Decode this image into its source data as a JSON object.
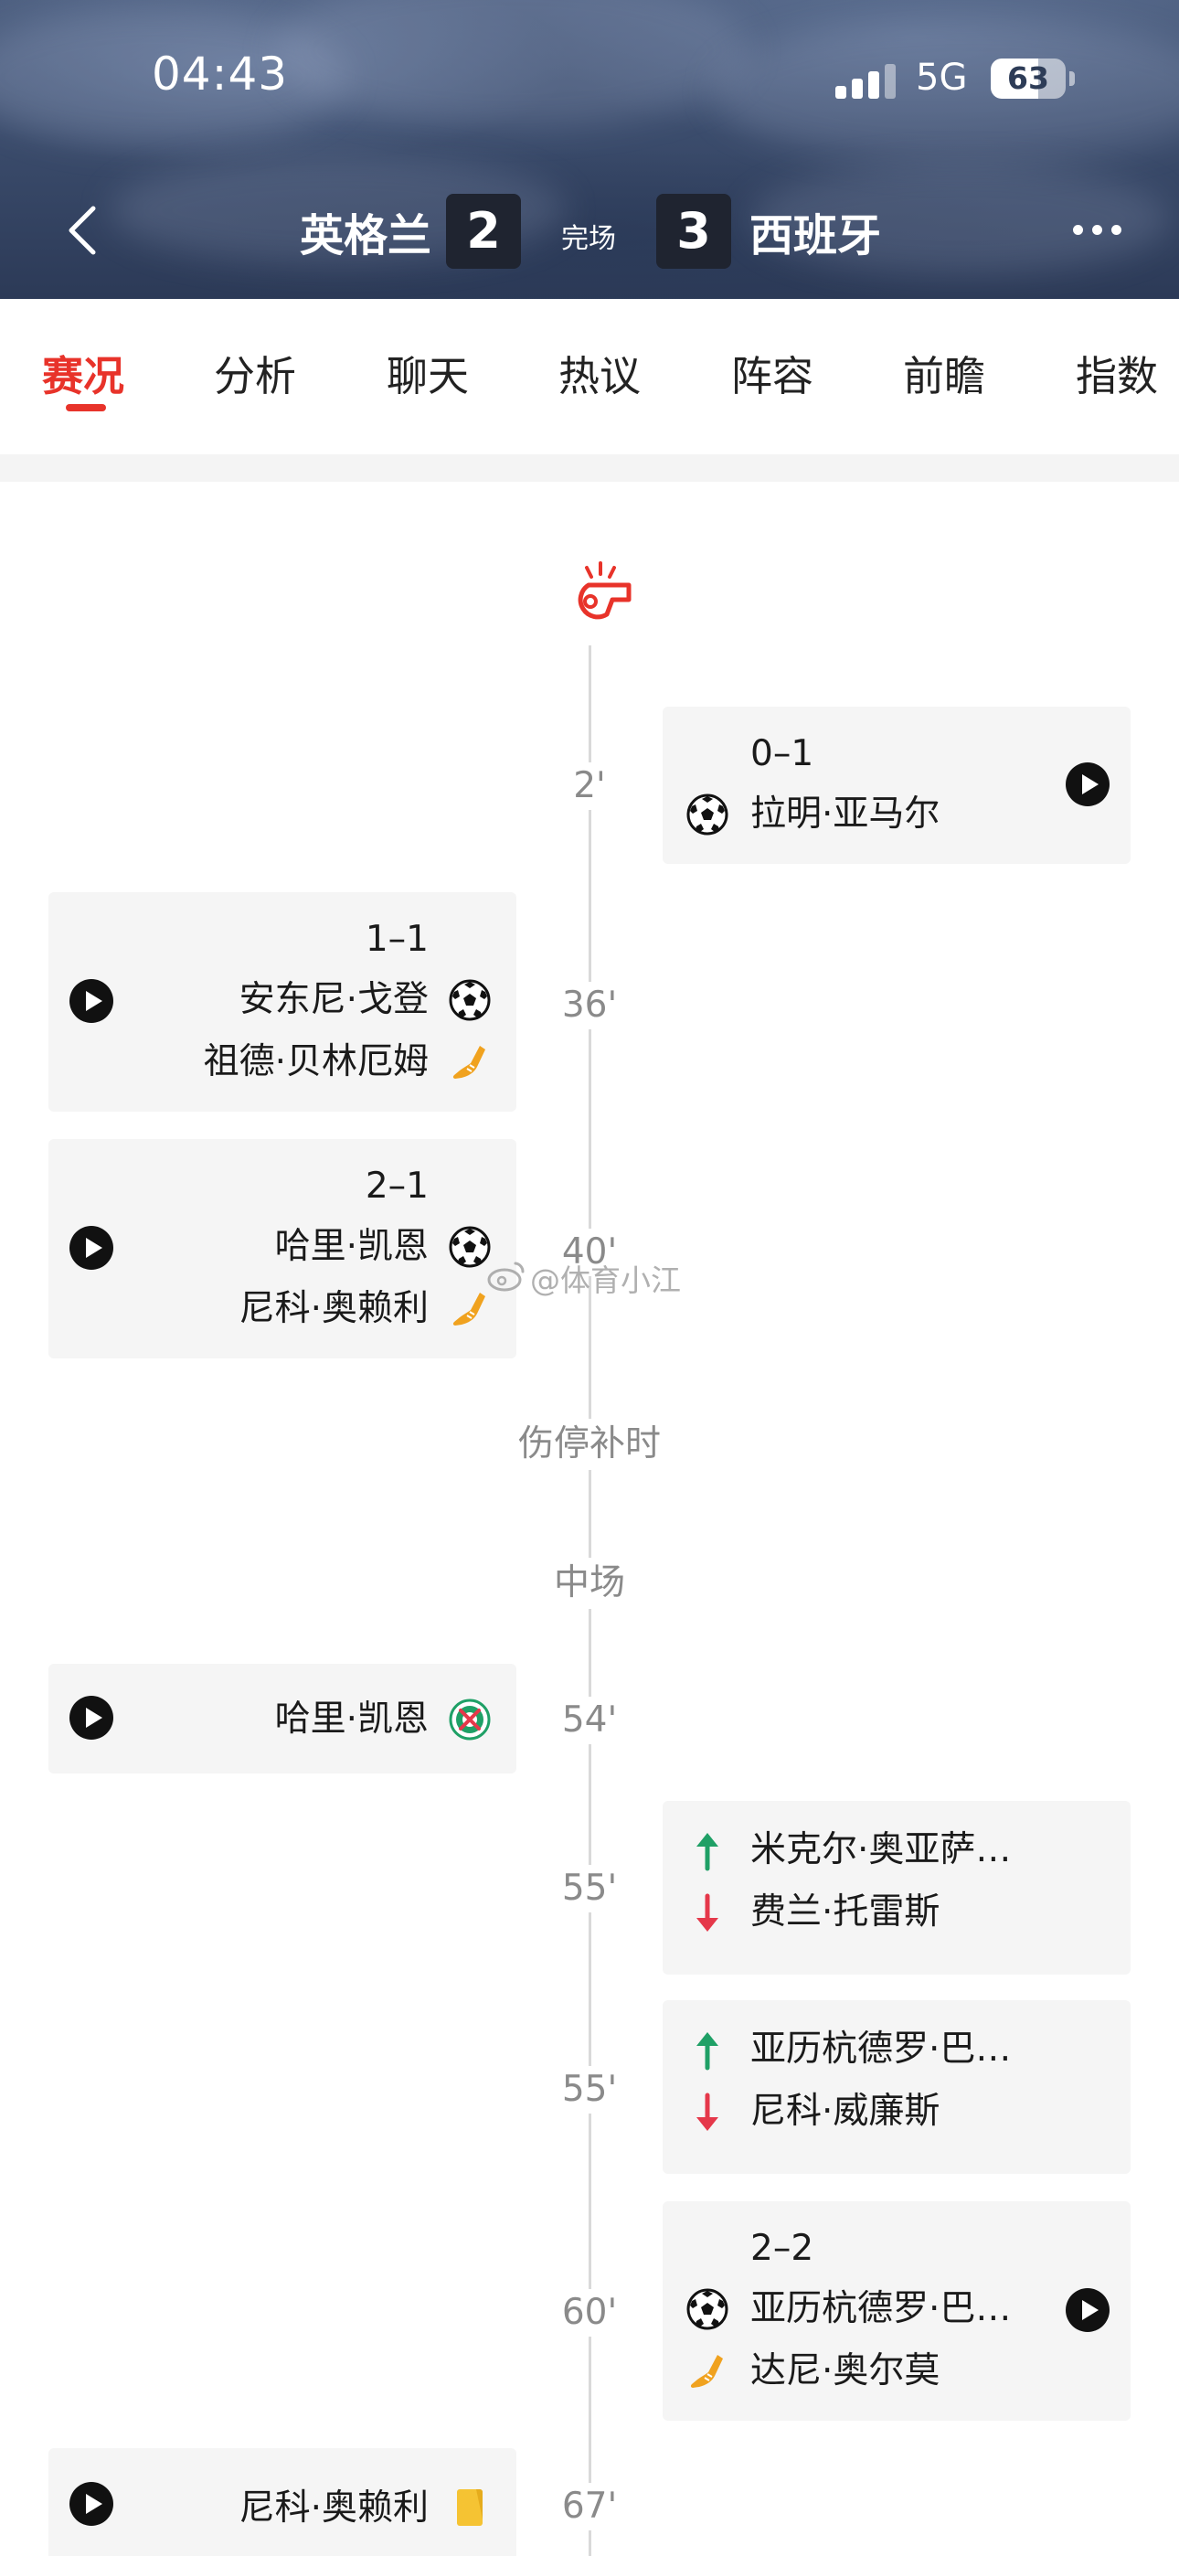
{
  "status_bar": {
    "time": "04:43",
    "network": "5G",
    "battery": "63",
    "battery_level": 0.63
  },
  "header": {
    "home_team": "英格兰",
    "home_score": "2",
    "status": "完场",
    "away_score": "3",
    "away_team": "西班牙"
  },
  "tabs": [
    {
      "label": "赛况",
      "active": true
    },
    {
      "label": "分析"
    },
    {
      "label": "聊天"
    },
    {
      "label": "热议"
    },
    {
      "label": "阵容"
    },
    {
      "label": "前瞻"
    },
    {
      "label": "指数"
    }
  ],
  "timeline": {
    "events": [
      {
        "minute": "2'",
        "side": "away",
        "score": "0–1",
        "lines": [
          {
            "text": "拉明·亚马尔",
            "icon": "football-icon"
          }
        ],
        "video": true
      },
      {
        "minute": "36'",
        "side": "home",
        "score": "1–1",
        "lines": [
          {
            "text": "安东尼·戈登",
            "icon": "football-icon"
          },
          {
            "text": "祖德·贝林厄姆",
            "icon": "assist-boot-icon"
          }
        ],
        "video": true
      },
      {
        "minute": "40'",
        "side": "home",
        "score": "2–1",
        "lines": [
          {
            "text": "哈里·凯恩",
            "icon": "football-icon"
          },
          {
            "text": "尼科·奥赖利",
            "icon": "assist-boot-icon"
          }
        ],
        "video": true
      },
      {
        "minute": "54'",
        "side": "home",
        "lines": [
          {
            "text": "哈里·凯恩",
            "icon": "disallowed-goal-icon"
          }
        ],
        "video": true
      },
      {
        "minute": "55'",
        "side": "away",
        "lines": [
          {
            "text": "米克尔·奥亚萨…",
            "icon": "sub-in-arrow-icon"
          },
          {
            "text": "费兰·托雷斯",
            "icon": "sub-out-arrow-icon"
          }
        ]
      },
      {
        "minute": "55'",
        "side": "away",
        "lines": [
          {
            "text": "亚历杭德罗·巴…",
            "icon": "sub-in-arrow-icon"
          },
          {
            "text": "尼科·威廉斯",
            "icon": "sub-out-arrow-icon"
          }
        ]
      },
      {
        "minute": "60'",
        "side": "away",
        "score": "2–2",
        "lines": [
          {
            "text": "亚历杭德罗·巴…",
            "icon": "football-icon"
          },
          {
            "text": "达尼·奥尔莫",
            "icon": "assist-boot-icon"
          }
        ],
        "video": true
      },
      {
        "minute": "67'",
        "side": "home",
        "lines": [
          {
            "text": "尼科·奥赖利",
            "icon": "yellow-card-icon"
          }
        ],
        "video": true
      }
    ],
    "stoppage_label": "伤停补时",
    "halftime_label": "中场"
  },
  "watermark": "@体育小江",
  "colors": {
    "accent_red": "#e8332a",
    "sub_in_green": "#1fa066",
    "sub_out_red": "#e5384a",
    "assist_orange": "#f0a21f",
    "yellow_card": "#f5c333"
  }
}
